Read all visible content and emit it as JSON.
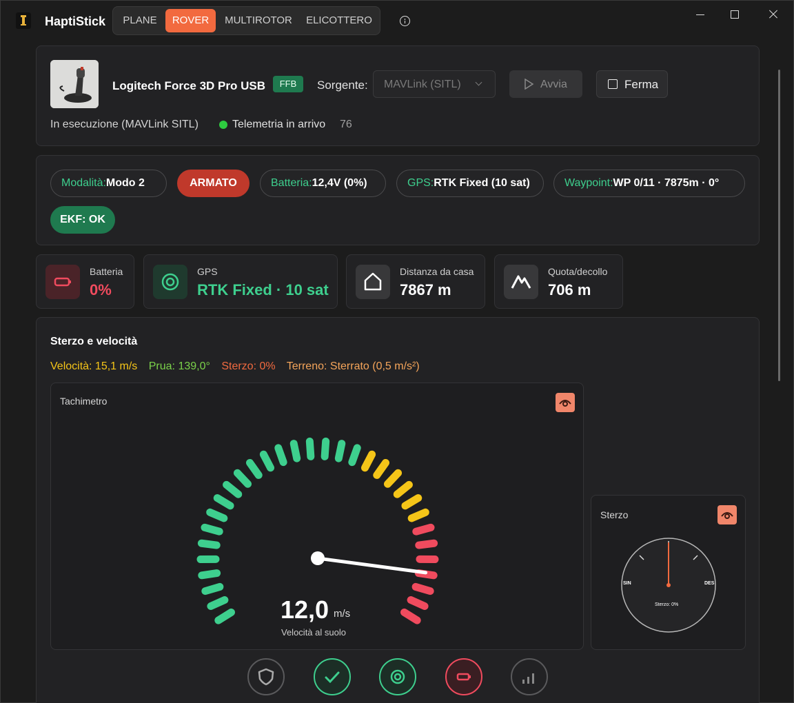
{
  "app": {
    "title": "HaptiStick",
    "modes": [
      "PLANE",
      "ROVER",
      "MULTIROTOR",
      "ELICOTTERO"
    ],
    "active_mode": "ROVER"
  },
  "device": {
    "name": "Logitech Force 3D Pro USB",
    "ffb_badge": "FFB",
    "source_label": "Sorgente:",
    "source_value": "MAVLink (SITL)",
    "start_label": "Avvia",
    "stop_label": "Ferma",
    "run_status": "In esecuzione (MAVLink SITL)",
    "telemetry_label": "Telemetria in arrivo",
    "telemetry_count": "76"
  },
  "status": {
    "mode_key": "Modalità:",
    "mode_value": "Modo 2",
    "armed": "ARMATO",
    "battery_key": "Batteria:",
    "battery_value": "12,4V (0%)",
    "gps_key": "GPS:",
    "gps_value": "RTK Fixed (10 sat)",
    "waypoint_key": "Waypoint:",
    "waypoint_value": "WP 0/11 · 7875m · 0°",
    "ekf": "EKF: OK"
  },
  "metrics": {
    "battery_label": "Batteria",
    "battery_value": "0%",
    "gps_label": "GPS",
    "gps_value": "RTK Fixed · 10 sat",
    "home_label": "Distanza da casa",
    "home_value": "7867 m",
    "alt_label": "Quota/decollo",
    "alt_value": "706 m"
  },
  "drive": {
    "title": "Sterzo e velocità",
    "speed_readout": "Velocità: 15,1 m/s",
    "heading_readout": "Prua: 139,0°",
    "steer_readout": "Sterzo: 0%",
    "terrain_readout": "Terreno: Sterrato (0,5 m/s²)",
    "speedo_title": "Tachimetro",
    "speedo_value": "12,0",
    "speedo_unit": "m/s",
    "speedo_caption": "Velocità al suolo",
    "speedo_fraction": 0.9,
    "steer_title": "Sterzo",
    "steer_left": "SIN",
    "steer_right": "DES",
    "steer_caption": "Sterzo: 0%",
    "steer_percent": 0
  },
  "colors": {
    "accent": "#f26a3f",
    "green": "#3ecf8e",
    "yellow": "#f5c518",
    "red": "#f04b5e",
    "orange_text": "#f5a55a"
  }
}
